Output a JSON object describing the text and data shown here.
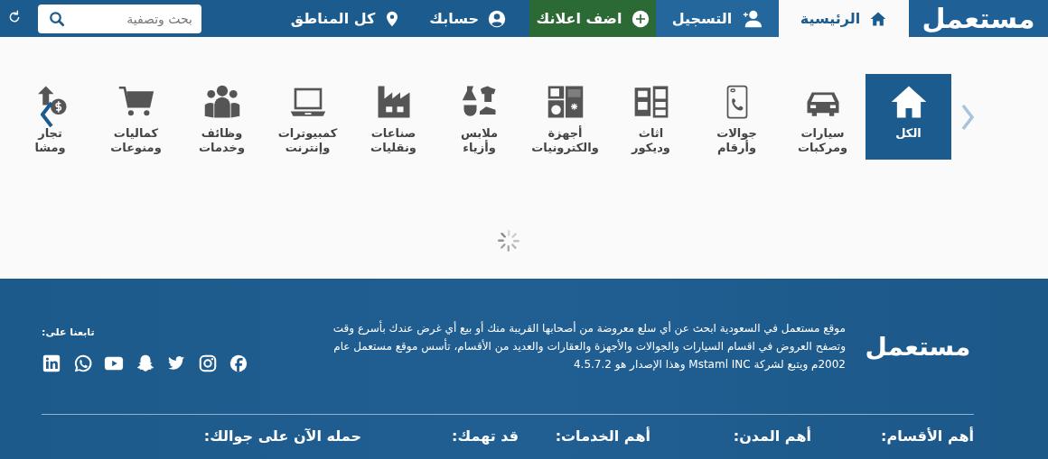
{
  "header": {
    "logo": "مستعمل",
    "nav": [
      {
        "label": "الرئيسية",
        "kind": "home",
        "selected": true
      },
      {
        "label": "التسجيل",
        "kind": "register",
        "selected": false
      },
      {
        "label": "اضف اعلانك",
        "kind": "add",
        "selected": false
      },
      {
        "label": "حسابك",
        "kind": "account",
        "selected": false
      },
      {
        "label": "كل المناطق",
        "kind": "regions",
        "selected": false
      }
    ],
    "search": {
      "placeholder": "بحث وتصفية"
    }
  },
  "categories": [
    {
      "label": "الكل",
      "selected": true
    },
    {
      "label": "سيارات ومركبات",
      "selected": false
    },
    {
      "label": "جوالات وأرقام",
      "selected": false
    },
    {
      "label": "اثاث وديكور",
      "selected": false
    },
    {
      "label": "أجهزة والكترونيات",
      "selected": false
    },
    {
      "label": "ملابس وأزياء",
      "selected": false
    },
    {
      "label": "صناعات ونقليات",
      "selected": false
    },
    {
      "label": "كمبيوترات وإنترنت",
      "selected": false
    },
    {
      "label": "وظائف وخدمات",
      "selected": false
    },
    {
      "label": "كماليات ومنوعات",
      "selected": false
    },
    {
      "label": "تجار ومشا",
      "selected": false
    }
  ],
  "footer": {
    "logo": "مستعمل",
    "about": "موقع مستعمل في السعودية ابحث عن أي سلع معروضة من أصحابها القريبة منك أو بيع أي غرض عندك بأسرع وقت وتصفح العروض في اقسام السيارات والجوالات والأجهزة والعقارات والعديد من الأقسام، تأسس موقع مستعمل عام 2002م ويتبع لشركة Mstaml INC وهذا الإصدار هو 4.5.7.2",
    "follow": "تابعنا على:",
    "headings": [
      "أهم الأقسام:",
      "أهم المدن:",
      "أهم الخدمات:",
      "قد تهمك:",
      "حمله الآن على جوالك:"
    ]
  }
}
